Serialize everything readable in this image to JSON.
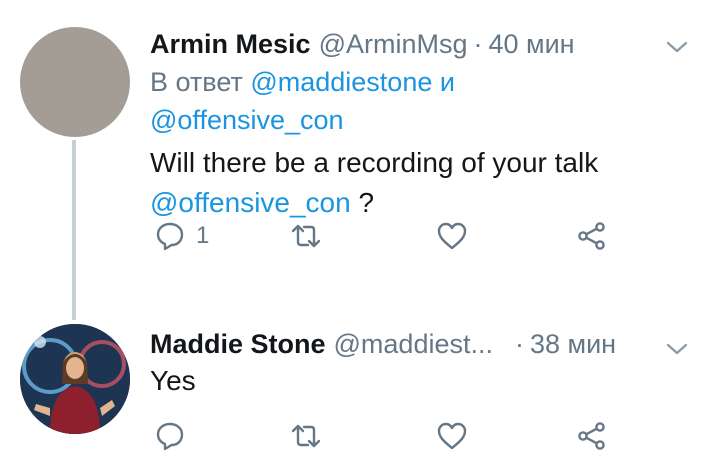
{
  "colors": {
    "link": "#1b95e0",
    "secondary_text": "#657786",
    "primary_text": "#14171a",
    "thread_line": "#c4cfd6"
  },
  "tweets": [
    {
      "author_name": "Armin Mesic",
      "handle": "@ArminMsg",
      "separator": "·",
      "time": "40 мин",
      "reply_prefix": "В ответ",
      "reply_mention_1": "@maddiestone",
      "reply_conjunction": "и",
      "reply_mention_2": "@offensive_con",
      "text_line_1": "Will there be a recording of your talk",
      "text_mention": "@offensive_con",
      "text_suffix": " ?",
      "reply_count": "1",
      "avatar_icon": "avatar-placeholder",
      "icons": [
        "chevron-down-icon",
        "reply-icon",
        "retweet-icon",
        "like-icon",
        "share-icon"
      ]
    },
    {
      "author_name": "Maddie Stone",
      "handle": "@maddiest...",
      "separator": "·",
      "time": "38 мин",
      "text": "Yes",
      "avatar_icon": "avatar-photo",
      "icons": [
        "chevron-down-icon",
        "reply-icon",
        "retweet-icon",
        "like-icon",
        "share-icon"
      ]
    }
  ]
}
